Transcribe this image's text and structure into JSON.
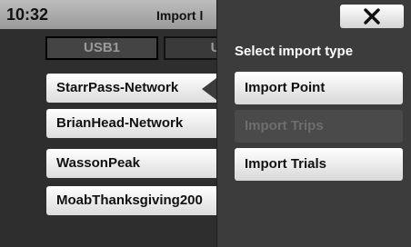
{
  "status": {
    "time": "10:32"
  },
  "header": {
    "title": "Import l"
  },
  "tabs": [
    {
      "label": "USB1"
    },
    {
      "label": "US"
    }
  ],
  "files": [
    {
      "name": "StarrPass-Network"
    },
    {
      "name": "BrianHead-Network"
    },
    {
      "name": "WassonPeak"
    },
    {
      "name": "MoabThanksgiving200"
    }
  ],
  "popup": {
    "heading": "Select import type",
    "close_icon": "close-icon",
    "options": [
      {
        "label": "Import Point",
        "enabled": true
      },
      {
        "label": "Import Trips",
        "enabled": false
      },
      {
        "label": "Import Trials",
        "enabled": true
      }
    ]
  }
}
